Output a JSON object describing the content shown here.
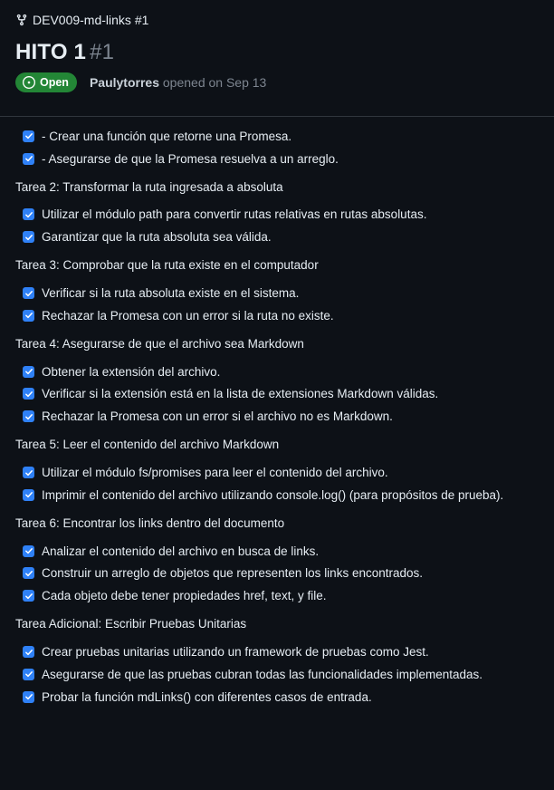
{
  "repo": {
    "name": "DEV009-md-links #1"
  },
  "issue": {
    "title": "HITO 1",
    "number": "#1",
    "state": "Open",
    "author": "Paulytorres",
    "opened_text": "opened on Sep 13"
  },
  "top_tasks": [
    "- Crear una función que retorne una Promesa.",
    "- Asegurarse de que la Promesa resuelva a un arreglo."
  ],
  "sections": [
    {
      "title": "Tarea 2: Transformar la ruta ingresada a absoluta",
      "tasks": [
        "Utilizar el módulo path para convertir rutas relativas en rutas absolutas.",
        "Garantizar que la ruta absoluta sea válida."
      ]
    },
    {
      "title": "Tarea 3: Comprobar que la ruta existe en el computador",
      "tasks": [
        "Verificar si la ruta absoluta existe en el sistema.",
        "Rechazar la Promesa con un error si la ruta no existe."
      ]
    },
    {
      "title": "Tarea 4: Asegurarse de que el archivo sea Markdown",
      "tasks": [
        "Obtener la extensión del archivo.",
        "Verificar si la extensión está en la lista de extensiones Markdown válidas.",
        "Rechazar la Promesa con un error si el archivo no es Markdown."
      ]
    },
    {
      "title": "Tarea 5: Leer el contenido del archivo Markdown",
      "tasks": [
        "Utilizar el módulo fs/promises para leer el contenido del archivo.",
        "Imprimir el contenido del archivo utilizando console.log() (para propósitos de prueba)."
      ]
    },
    {
      "title": "Tarea 6: Encontrar los links dentro del documento",
      "tasks": [
        "Analizar el contenido del archivo en busca de links.",
        "Construir un arreglo de objetos que representen los links encontrados.",
        "Cada objeto debe tener propiedades href, text, y file."
      ]
    },
    {
      "title": "Tarea Adicional: Escribir Pruebas Unitarias",
      "tasks": [
        "Crear pruebas unitarias utilizando un framework de pruebas como Jest.",
        "Asegurarse de que las pruebas cubran todas las funcionalidades implementadas.",
        "Probar la función mdLinks() con diferentes casos de entrada."
      ]
    }
  ],
  "colors": {
    "background": "#0d1117",
    "open_badge": "#238636",
    "checkbox": "#2f81f7",
    "muted": "#7d8590"
  },
  "icons": {
    "repo": "repo-forked-icon",
    "state": "issue-opened-icon",
    "check": "checkmark-icon"
  }
}
